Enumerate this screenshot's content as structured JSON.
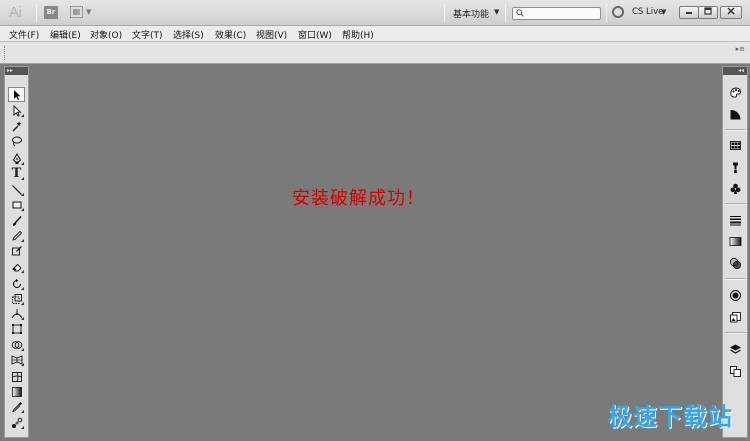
{
  "titlebar": {
    "app_logo": "Ai",
    "bridge_label": "Br",
    "workspace_label": "基本功能",
    "search_placeholder": "",
    "cs_live_label": "CS Live",
    "minimize_icon": "minimize-icon",
    "restore_icon": "restore-icon",
    "close_icon": "close-icon"
  },
  "menubar": {
    "items": [
      {
        "label": "文件(F)"
      },
      {
        "label": "编辑(E)"
      },
      {
        "label": "对象(O)"
      },
      {
        "label": "文字(T)"
      },
      {
        "label": "选择(S)"
      },
      {
        "label": "效果(C)"
      },
      {
        "label": "视图(V)"
      },
      {
        "label": "窗口(W)"
      },
      {
        "label": "帮助(H)"
      }
    ]
  },
  "tools": {
    "header": "▸▸",
    "items": [
      {
        "name": "selection-tool-icon",
        "selected": true
      },
      {
        "name": "direct-selection-tool-icon"
      },
      {
        "name": "magic-wand-tool-icon"
      },
      {
        "name": "lasso-tool-icon"
      },
      {
        "name": "pen-tool-icon"
      },
      {
        "name": "type-tool-icon",
        "glyph": "T"
      },
      {
        "name": "line-segment-tool-icon"
      },
      {
        "name": "rectangle-tool-icon"
      },
      {
        "name": "paintbrush-tool-icon"
      },
      {
        "name": "pencil-tool-icon"
      },
      {
        "name": "blob-brush-tool-icon"
      },
      {
        "name": "eraser-tool-icon"
      },
      {
        "name": "rotate-tool-icon"
      },
      {
        "name": "scale-tool-icon"
      },
      {
        "name": "width-tool-icon"
      },
      {
        "name": "free-transform-tool-icon"
      },
      {
        "name": "shape-builder-tool-icon"
      },
      {
        "name": "perspective-grid-tool-icon"
      },
      {
        "name": "mesh-tool-icon"
      },
      {
        "name": "gradient-tool-icon"
      },
      {
        "name": "eyedropper-tool-icon"
      },
      {
        "name": "blend-tool-icon"
      }
    ]
  },
  "dock": {
    "header": "◂◂",
    "items": [
      {
        "name": "color-panel-icon"
      },
      {
        "name": "color-guide-panel-icon"
      },
      {
        "name": "swatches-panel-icon"
      },
      {
        "name": "brushes-panel-icon"
      },
      {
        "name": "symbols-panel-icon"
      },
      {
        "name": "stroke-panel-icon"
      },
      {
        "name": "gradient-panel-icon"
      },
      {
        "name": "transparency-panel-icon"
      },
      {
        "name": "appearance-panel-icon"
      },
      {
        "name": "graphic-styles-panel-icon"
      },
      {
        "name": "layers-panel-icon"
      },
      {
        "name": "artboards-panel-icon"
      }
    ]
  },
  "canvas": {
    "message": "安装破解成功！",
    "message_color": "#d40000"
  },
  "watermark": {
    "text": "极速下载站",
    "color": "#35a6e8"
  }
}
